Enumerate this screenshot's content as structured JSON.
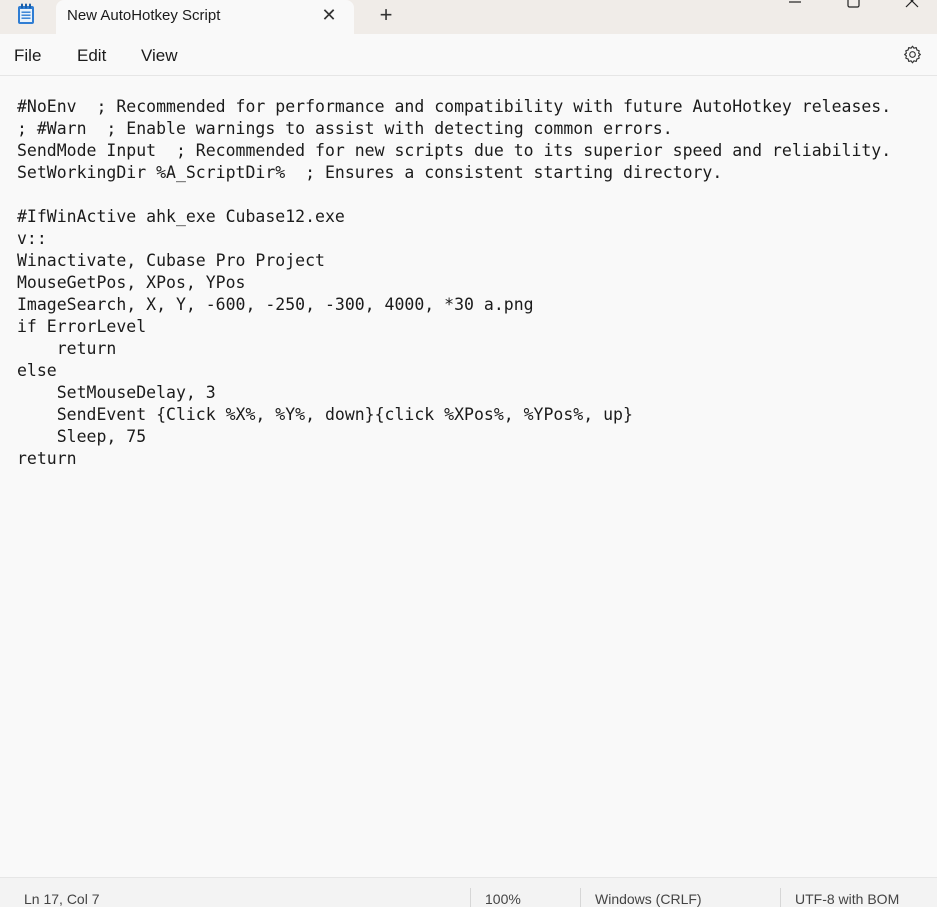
{
  "window": {
    "tab_title": "New AutoHotkey Script",
    "new_tab_symbol": "+",
    "close_tab_symbol": "✕"
  },
  "menu": {
    "file": "File",
    "edit": "Edit",
    "view": "View"
  },
  "editor": {
    "content": "#NoEnv  ; Recommended for performance and compatibility with future AutoHotkey releases.\n; #Warn  ; Enable warnings to assist with detecting common errors.\nSendMode Input  ; Recommended for new scripts due to its superior speed and reliability.\nSetWorkingDir %A_ScriptDir%  ; Ensures a consistent starting directory.\n\n#IfWinActive ahk_exe Cubase12.exe\nv::\nWinactivate, Cubase Pro Project\nMouseGetPos, XPos, YPos\nImageSearch, X, Y, -600, -250, -300, 4000, *30 a.png\nif ErrorLevel\n    return\nelse\n    SetMouseDelay, 3\n    SendEvent {Click %X%, %Y%, down}{click %XPos%, %YPos%, up}\n    Sleep, 75\nreturn"
  },
  "status": {
    "position": "Ln 17, Col 7",
    "zoom": "100%",
    "line_ending": "Windows (CRLF)",
    "encoding": "UTF-8 with BOM"
  },
  "colors": {
    "titlebar_bg": "#f0ece8",
    "editor_bg": "#f9f9f9",
    "app_icon_blue": "#2f7dd3"
  }
}
